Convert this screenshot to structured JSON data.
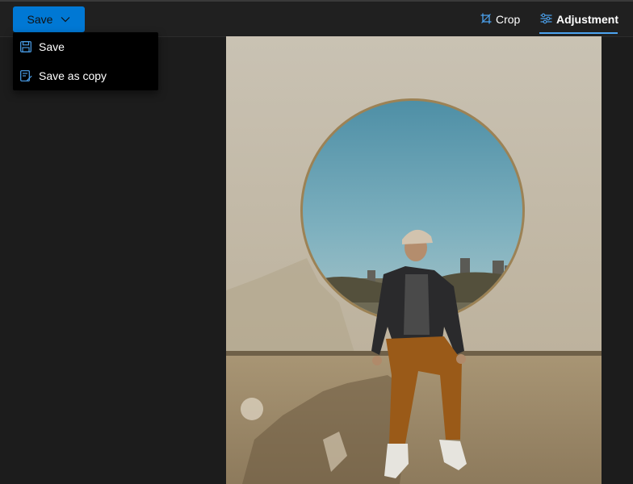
{
  "toolbar": {
    "save_label": "Save",
    "tabs": {
      "crop": "Crop",
      "adjustment": "Adjustment"
    },
    "active_tab": "adjustment"
  },
  "save_menu": {
    "items": [
      {
        "label": "Save",
        "icon": "save-icon"
      },
      {
        "label": "Save as copy",
        "icon": "save-as-copy-icon"
      }
    ]
  },
  "colors": {
    "accent": "#0078d4",
    "active_underline": "#4ca3f0",
    "background": "#1c1c1c",
    "menu_background": "#000000"
  }
}
